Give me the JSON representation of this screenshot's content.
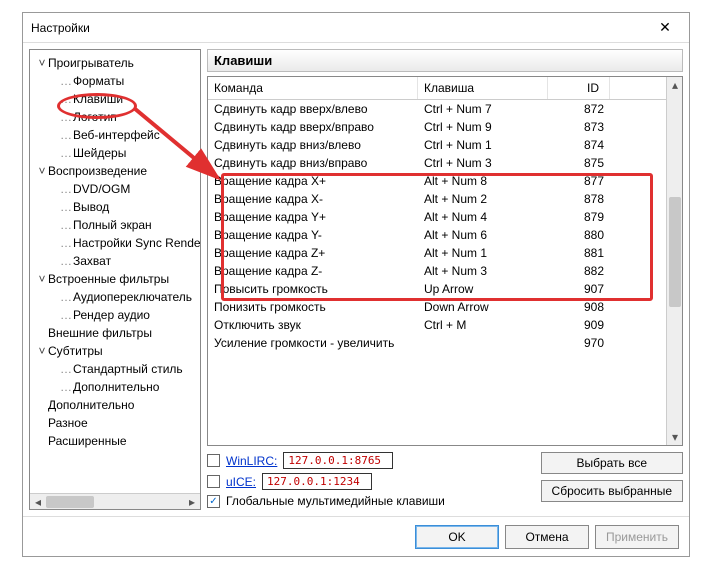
{
  "window": {
    "title": "Настройки"
  },
  "tree": [
    {
      "label": "Проигрыватель",
      "level": 0,
      "exp": "˅"
    },
    {
      "label": "Форматы",
      "level": 1
    },
    {
      "label": "Клавиши",
      "level": 1,
      "highlighted": true
    },
    {
      "label": "Логотип",
      "level": 1
    },
    {
      "label": "Веб-интерфейс",
      "level": 1
    },
    {
      "label": "Шейдеры",
      "level": 1
    },
    {
      "label": "Воспроизведение",
      "level": 0,
      "exp": "˅"
    },
    {
      "label": "DVD/OGM",
      "level": 1
    },
    {
      "label": "Вывод",
      "level": 1
    },
    {
      "label": "Полный экран",
      "level": 1
    },
    {
      "label": "Настройки Sync Render",
      "level": 1
    },
    {
      "label": "Захват",
      "level": 1
    },
    {
      "label": "Встроенные фильтры",
      "level": 0,
      "exp": "˅"
    },
    {
      "label": "Аудиопереключатель",
      "level": 1
    },
    {
      "label": "Рендер аудио",
      "level": 1
    },
    {
      "label": "Внешние фильтры",
      "level": 0
    },
    {
      "label": "Субтитры",
      "level": 0,
      "exp": "˅"
    },
    {
      "label": "Стандартный стиль",
      "level": 1
    },
    {
      "label": "Дополнительно",
      "level": 1
    },
    {
      "label": "Дополнительно",
      "level": 0
    },
    {
      "label": "Разное",
      "level": 0
    },
    {
      "label": "Расширенные",
      "level": 0
    }
  ],
  "section_title": "Клавиши",
  "table": {
    "headers": {
      "cmd": "Команда",
      "key": "Клавиша",
      "id": "ID"
    },
    "rows": [
      {
        "cmd": "Сдвинуть кадр вверх/влево",
        "key": "Ctrl + Num 7",
        "id": "872"
      },
      {
        "cmd": "Сдвинуть кадр вверх/вправо",
        "key": "Ctrl + Num 9",
        "id": "873"
      },
      {
        "cmd": "Сдвинуть кадр вниз/влево",
        "key": "Ctrl + Num 1",
        "id": "874"
      },
      {
        "cmd": "Сдвинуть кадр вниз/вправо",
        "key": "Ctrl + Num 3",
        "id": "875"
      },
      {
        "cmd": "Вращение кадра X+",
        "key": "Alt + Num 8",
        "id": "877"
      },
      {
        "cmd": "Вращение кадра X-",
        "key": "Alt + Num 2",
        "id": "878"
      },
      {
        "cmd": "Вращение кадра Y+",
        "key": "Alt + Num 4",
        "id": "879"
      },
      {
        "cmd": "Вращение кадра Y-",
        "key": "Alt + Num 6",
        "id": "880"
      },
      {
        "cmd": "Вращение кадра Z+",
        "key": "Alt + Num 1",
        "id": "881"
      },
      {
        "cmd": "Вращение кадра Z-",
        "key": "Alt + Num 3",
        "id": "882"
      },
      {
        "cmd": "Повысить громкость",
        "key": "Up Arrow",
        "id": "907"
      },
      {
        "cmd": "Понизить громкость",
        "key": "Down Arrow",
        "id": "908"
      },
      {
        "cmd": "Отключить звук",
        "key": "Ctrl + M",
        "id": "909"
      },
      {
        "cmd": "Усиление громкости - увеличить",
        "key": "",
        "id": "970"
      }
    ]
  },
  "options": {
    "winlirc": {
      "label": "WinLIRC:",
      "addr": "127.0.0.1:8765",
      "checked": false
    },
    "uice": {
      "label": "uICE:",
      "addr": "127.0.0.1:1234",
      "checked": false
    },
    "global": {
      "label": "Глобальные мультимедийные клавиши",
      "checked": true
    }
  },
  "buttons": {
    "select_all": "Выбрать все",
    "reset": "Сбросить выбранные"
  },
  "footer": {
    "ok": "OK",
    "cancel": "Отмена",
    "apply": "Применить"
  }
}
